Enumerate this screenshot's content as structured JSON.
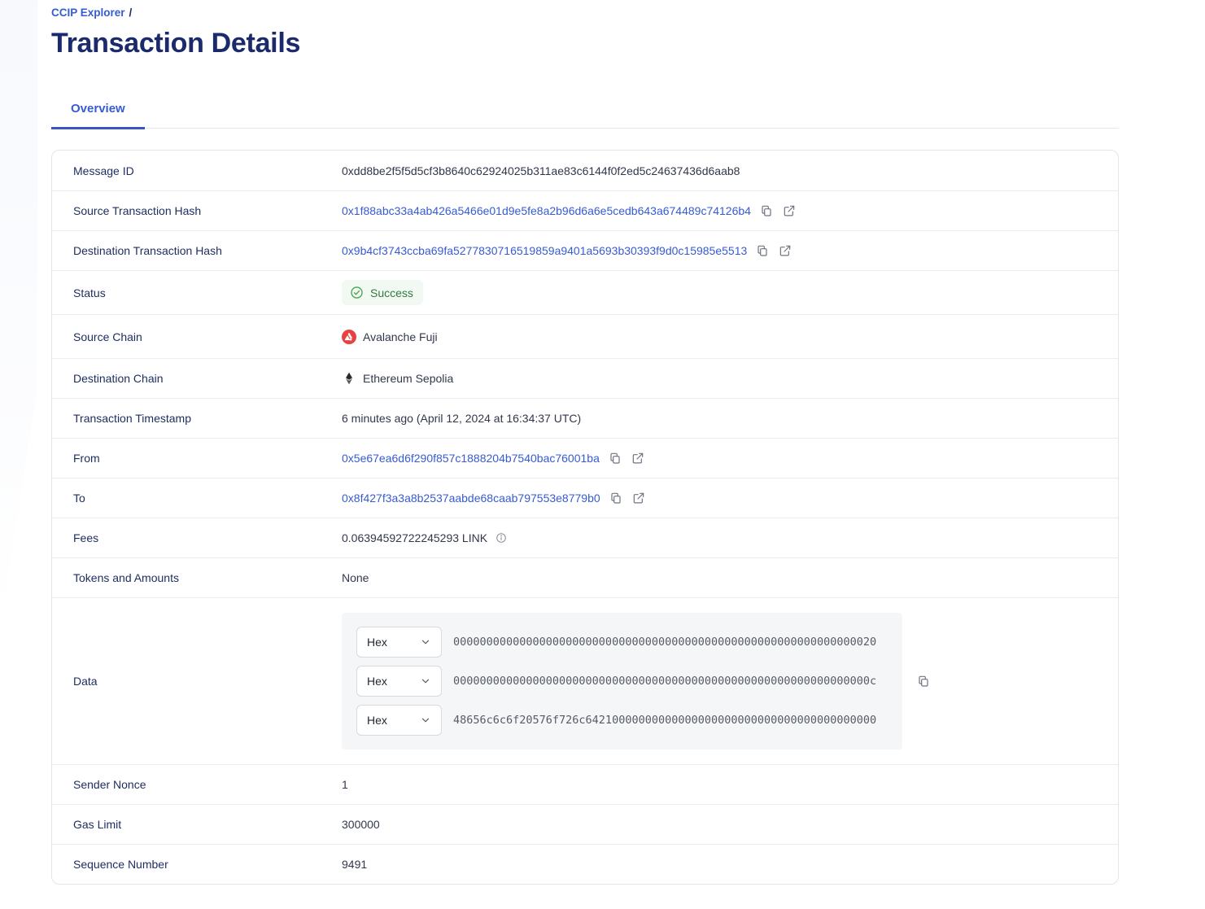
{
  "breadcrumb": {
    "link_label": "CCIP Explorer",
    "separator": "/"
  },
  "page": {
    "title": "Transaction Details"
  },
  "tabs": {
    "overview": "Overview"
  },
  "fields": {
    "message_id": {
      "label": "Message ID",
      "value": "0xdd8be2f5f5d5cf3b8640c62924025b311ae83c6144f0f2ed5c24637436d6aab8"
    },
    "source_tx_hash": {
      "label": "Source Transaction Hash",
      "value": "0x1f88abc33a4ab426a5466e01d9e5fe8a2b96d6a6e5cedb643a674489c74126b4"
    },
    "dest_tx_hash": {
      "label": "Destination Transaction Hash",
      "value": "0x9b4cf3743ccba69fa5277830716519859a9401a5693b30393f9d0c15985e5513"
    },
    "status": {
      "label": "Status",
      "value": "Success"
    },
    "source_chain": {
      "label": "Source Chain",
      "value": "Avalanche Fuji"
    },
    "dest_chain": {
      "label": "Destination Chain",
      "value": "Ethereum Sepolia"
    },
    "timestamp": {
      "label": "Transaction Timestamp",
      "value": "6 minutes ago (April 12, 2024 at 16:34:37 UTC)"
    },
    "from": {
      "label": "From",
      "value": "0x5e67ea6d6f290f857c1888204b7540bac76001ba"
    },
    "to": {
      "label": "To",
      "value": "0x8f427f3a3a8b2537aabde68caab797553e8779b0"
    },
    "fees": {
      "label": "Fees",
      "value": "0.06394592722245293 LINK"
    },
    "tokens": {
      "label": "Tokens and Amounts",
      "value": "None"
    },
    "data": {
      "label": "Data"
    },
    "sender_nonce": {
      "label": "Sender Nonce",
      "value": "1"
    },
    "gas_limit": {
      "label": "Gas Limit",
      "value": "300000"
    },
    "sequence_number": {
      "label": "Sequence Number",
      "value": "9491"
    }
  },
  "data_section": {
    "rows": [
      {
        "format": "Hex",
        "value": "0000000000000000000000000000000000000000000000000000000000000020"
      },
      {
        "format": "Hex",
        "value": "000000000000000000000000000000000000000000000000000000000000000c"
      },
      {
        "format": "Hex",
        "value": "48656c6c6f20576f726c64210000000000000000000000000000000000000000"
      }
    ]
  },
  "icons": {
    "copy": "copy-icon",
    "external_link": "external-link-icon",
    "check_circle": "check-circle-icon",
    "avalanche": "avalanche-icon",
    "ethereum": "ethereum-icon",
    "info": "info-icon",
    "chevron_down": "chevron-down-icon"
  },
  "colors": {
    "accent_blue": "#375bd2",
    "title_navy": "#1b2a6b",
    "success_green": "#327a3d",
    "success_bg": "#f2f9f3",
    "avalanche_red": "#e84142",
    "card_border": "#e3e5e8",
    "data_panel_bg": "#f5f6f8"
  }
}
